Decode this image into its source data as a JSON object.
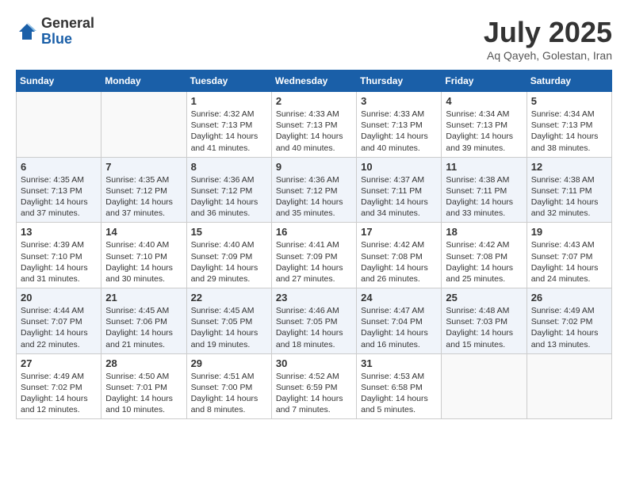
{
  "header": {
    "logo_general": "General",
    "logo_blue": "Blue",
    "month_title": "July 2025",
    "location": "Aq Qayeh, Golestan, Iran"
  },
  "days_of_week": [
    "Sunday",
    "Monday",
    "Tuesday",
    "Wednesday",
    "Thursday",
    "Friday",
    "Saturday"
  ],
  "weeks": [
    [
      {
        "day": "",
        "text": ""
      },
      {
        "day": "",
        "text": ""
      },
      {
        "day": "1",
        "text": "Sunrise: 4:32 AM\nSunset: 7:13 PM\nDaylight: 14 hours and 41 minutes."
      },
      {
        "day": "2",
        "text": "Sunrise: 4:33 AM\nSunset: 7:13 PM\nDaylight: 14 hours and 40 minutes."
      },
      {
        "day": "3",
        "text": "Sunrise: 4:33 AM\nSunset: 7:13 PM\nDaylight: 14 hours and 40 minutes."
      },
      {
        "day": "4",
        "text": "Sunrise: 4:34 AM\nSunset: 7:13 PM\nDaylight: 14 hours and 39 minutes."
      },
      {
        "day": "5",
        "text": "Sunrise: 4:34 AM\nSunset: 7:13 PM\nDaylight: 14 hours and 38 minutes."
      }
    ],
    [
      {
        "day": "6",
        "text": "Sunrise: 4:35 AM\nSunset: 7:13 PM\nDaylight: 14 hours and 37 minutes."
      },
      {
        "day": "7",
        "text": "Sunrise: 4:35 AM\nSunset: 7:12 PM\nDaylight: 14 hours and 37 minutes."
      },
      {
        "day": "8",
        "text": "Sunrise: 4:36 AM\nSunset: 7:12 PM\nDaylight: 14 hours and 36 minutes."
      },
      {
        "day": "9",
        "text": "Sunrise: 4:36 AM\nSunset: 7:12 PM\nDaylight: 14 hours and 35 minutes."
      },
      {
        "day": "10",
        "text": "Sunrise: 4:37 AM\nSunset: 7:11 PM\nDaylight: 14 hours and 34 minutes."
      },
      {
        "day": "11",
        "text": "Sunrise: 4:38 AM\nSunset: 7:11 PM\nDaylight: 14 hours and 33 minutes."
      },
      {
        "day": "12",
        "text": "Sunrise: 4:38 AM\nSunset: 7:11 PM\nDaylight: 14 hours and 32 minutes."
      }
    ],
    [
      {
        "day": "13",
        "text": "Sunrise: 4:39 AM\nSunset: 7:10 PM\nDaylight: 14 hours and 31 minutes."
      },
      {
        "day": "14",
        "text": "Sunrise: 4:40 AM\nSunset: 7:10 PM\nDaylight: 14 hours and 30 minutes."
      },
      {
        "day": "15",
        "text": "Sunrise: 4:40 AM\nSunset: 7:09 PM\nDaylight: 14 hours and 29 minutes."
      },
      {
        "day": "16",
        "text": "Sunrise: 4:41 AM\nSunset: 7:09 PM\nDaylight: 14 hours and 27 minutes."
      },
      {
        "day": "17",
        "text": "Sunrise: 4:42 AM\nSunset: 7:08 PM\nDaylight: 14 hours and 26 minutes."
      },
      {
        "day": "18",
        "text": "Sunrise: 4:42 AM\nSunset: 7:08 PM\nDaylight: 14 hours and 25 minutes."
      },
      {
        "day": "19",
        "text": "Sunrise: 4:43 AM\nSunset: 7:07 PM\nDaylight: 14 hours and 24 minutes."
      }
    ],
    [
      {
        "day": "20",
        "text": "Sunrise: 4:44 AM\nSunset: 7:07 PM\nDaylight: 14 hours and 22 minutes."
      },
      {
        "day": "21",
        "text": "Sunrise: 4:45 AM\nSunset: 7:06 PM\nDaylight: 14 hours and 21 minutes."
      },
      {
        "day": "22",
        "text": "Sunrise: 4:45 AM\nSunset: 7:05 PM\nDaylight: 14 hours and 19 minutes."
      },
      {
        "day": "23",
        "text": "Sunrise: 4:46 AM\nSunset: 7:05 PM\nDaylight: 14 hours and 18 minutes."
      },
      {
        "day": "24",
        "text": "Sunrise: 4:47 AM\nSunset: 7:04 PM\nDaylight: 14 hours and 16 minutes."
      },
      {
        "day": "25",
        "text": "Sunrise: 4:48 AM\nSunset: 7:03 PM\nDaylight: 14 hours and 15 minutes."
      },
      {
        "day": "26",
        "text": "Sunrise: 4:49 AM\nSunset: 7:02 PM\nDaylight: 14 hours and 13 minutes."
      }
    ],
    [
      {
        "day": "27",
        "text": "Sunrise: 4:49 AM\nSunset: 7:02 PM\nDaylight: 14 hours and 12 minutes."
      },
      {
        "day": "28",
        "text": "Sunrise: 4:50 AM\nSunset: 7:01 PM\nDaylight: 14 hours and 10 minutes."
      },
      {
        "day": "29",
        "text": "Sunrise: 4:51 AM\nSunset: 7:00 PM\nDaylight: 14 hours and 8 minutes."
      },
      {
        "day": "30",
        "text": "Sunrise: 4:52 AM\nSunset: 6:59 PM\nDaylight: 14 hours and 7 minutes."
      },
      {
        "day": "31",
        "text": "Sunrise: 4:53 AM\nSunset: 6:58 PM\nDaylight: 14 hours and 5 minutes."
      },
      {
        "day": "",
        "text": ""
      },
      {
        "day": "",
        "text": ""
      }
    ]
  ]
}
